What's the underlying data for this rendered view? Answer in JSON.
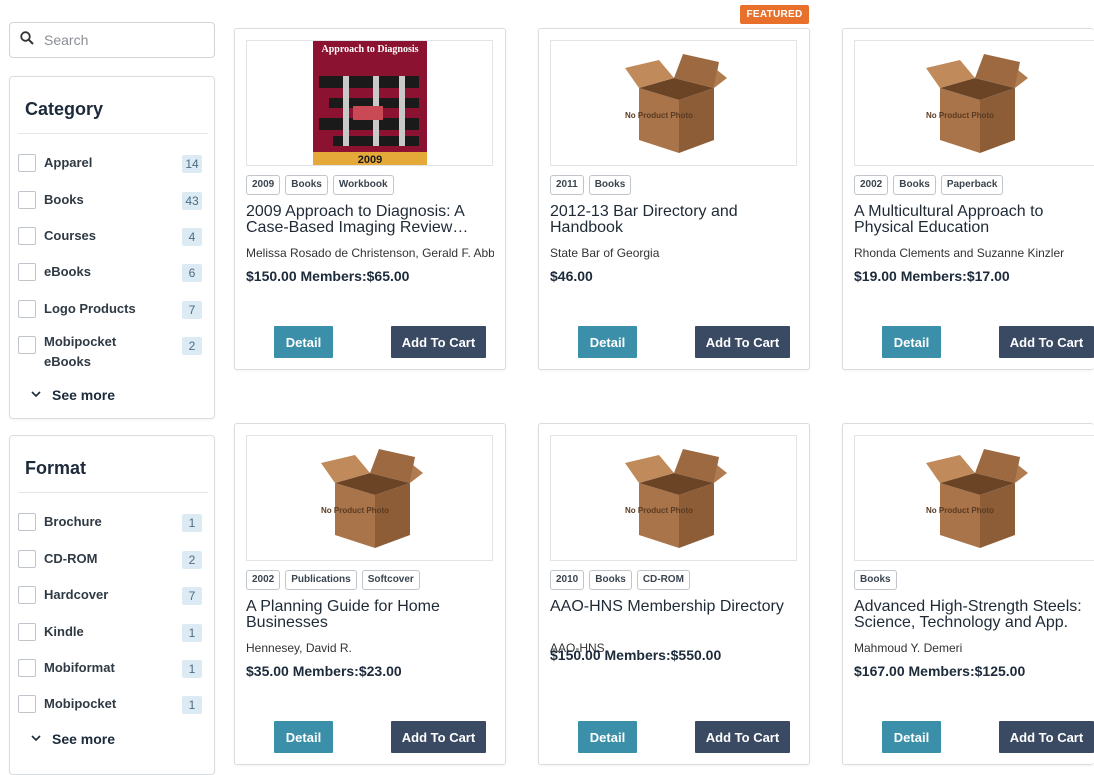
{
  "search": {
    "placeholder": "Search",
    "icon": "search-icon"
  },
  "category": {
    "title": "Category",
    "items": [
      {
        "label": "Apparel",
        "count": "14"
      },
      {
        "label": "Books",
        "count": "43"
      },
      {
        "label": "Courses",
        "count": "4"
      },
      {
        "label": "eBooks",
        "count": "6"
      },
      {
        "label": "Logo Products",
        "count": "7"
      },
      {
        "label": "Mobipocket eBooks",
        "count": "2"
      }
    ],
    "see_more": "See more"
  },
  "format": {
    "title": "Format",
    "items": [
      {
        "label": "Brochure",
        "count": "1"
      },
      {
        "label": "CD-ROM",
        "count": "2"
      },
      {
        "label": "Hardcover",
        "count": "7"
      },
      {
        "label": "Kindle",
        "count": "1"
      },
      {
        "label": "Mobiformat",
        "count": "1"
      },
      {
        "label": "Mobipocket",
        "count": "1"
      }
    ],
    "see_more": "See more"
  },
  "featured_badge": "FEATURED",
  "buttons": {
    "detail": "Detail",
    "add_to_cart": "Add To Cart"
  },
  "products": [
    {
      "tags": [
        "2009",
        "Books",
        "Workbook"
      ],
      "title": "2009 Approach to Diagnosis: A Case-Based Imaging Review…",
      "author": "Melissa Rosado de Christenson, Gerald F. Abbott",
      "price": "$150.00 Members:$65.00",
      "cover": {
        "title": "Approach to Diagnosis",
        "year": "2009"
      }
    },
    {
      "tags": [
        "2011",
        "Books"
      ],
      "title": "2012-13 Bar Directory and Handbook",
      "author": "State Bar of Georgia",
      "price": "$46.00",
      "placeholder": "No Product Photo"
    },
    {
      "tags": [
        "2002",
        "Books",
        "Paperback"
      ],
      "title": "A Multicultural Approach to Physical Education",
      "author": "Rhonda Clements and Suzanne Kinzler",
      "price": "$19.00 Members:$17.00",
      "placeholder": "No Product Photo"
    },
    {
      "tags": [
        "2002",
        "Publications",
        "Softcover"
      ],
      "title": "A Planning Guide for Home Businesses",
      "author": "Hennesey, David R.",
      "price": "$35.00 Members:$23.00",
      "placeholder": "No Product Photo"
    },
    {
      "tags": [
        "2010",
        "Books",
        "CD-ROM"
      ],
      "title": "AAO-HNS Membership Directory",
      "author": "AAO-HNS",
      "price": "$150.00 Members:$550.00",
      "placeholder": "No Product Photo"
    },
    {
      "tags": [
        "Books"
      ],
      "title": "Advanced High-Strength Steels: Science, Technology and App.",
      "author": "Mahmoud Y. Demeri",
      "price": "$167.00 Members:$125.00",
      "placeholder": "No Product Photo"
    }
  ]
}
